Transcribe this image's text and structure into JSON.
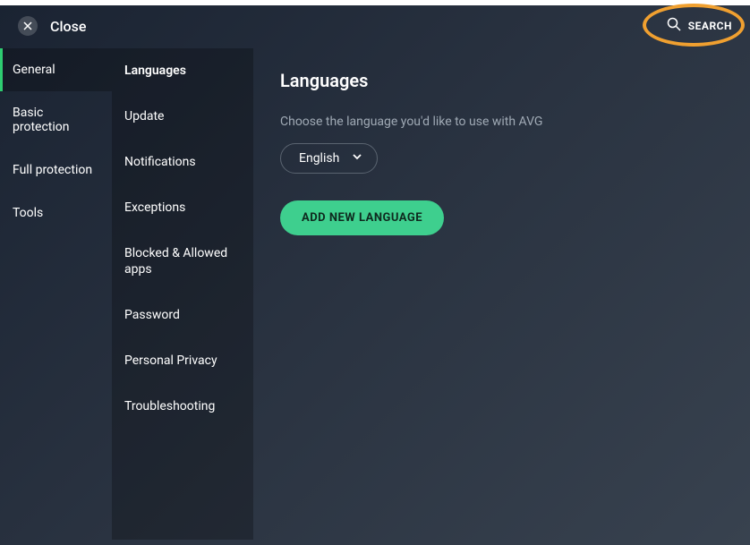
{
  "header": {
    "close_label": "Close",
    "search_label": "SEARCH"
  },
  "sidebar_primary": [
    {
      "label": "General",
      "active": true
    },
    {
      "label": "Basic protection",
      "active": false
    },
    {
      "label": "Full protection",
      "active": false
    },
    {
      "label": "Tools",
      "active": false
    }
  ],
  "sidebar_secondary": [
    {
      "label": "Languages",
      "active": true
    },
    {
      "label": "Update",
      "active": false
    },
    {
      "label": "Notifications",
      "active": false
    },
    {
      "label": "Exceptions",
      "active": false
    },
    {
      "label": "Blocked & Allowed apps",
      "active": false
    },
    {
      "label": "Password",
      "active": false
    },
    {
      "label": "Personal Privacy",
      "active": false
    },
    {
      "label": "Troubleshooting",
      "active": false
    }
  ],
  "content": {
    "title": "Languages",
    "subtitle": "Choose the language you'd like to use with AVG",
    "selected_language": "English",
    "add_button": "ADD NEW LANGUAGE"
  }
}
